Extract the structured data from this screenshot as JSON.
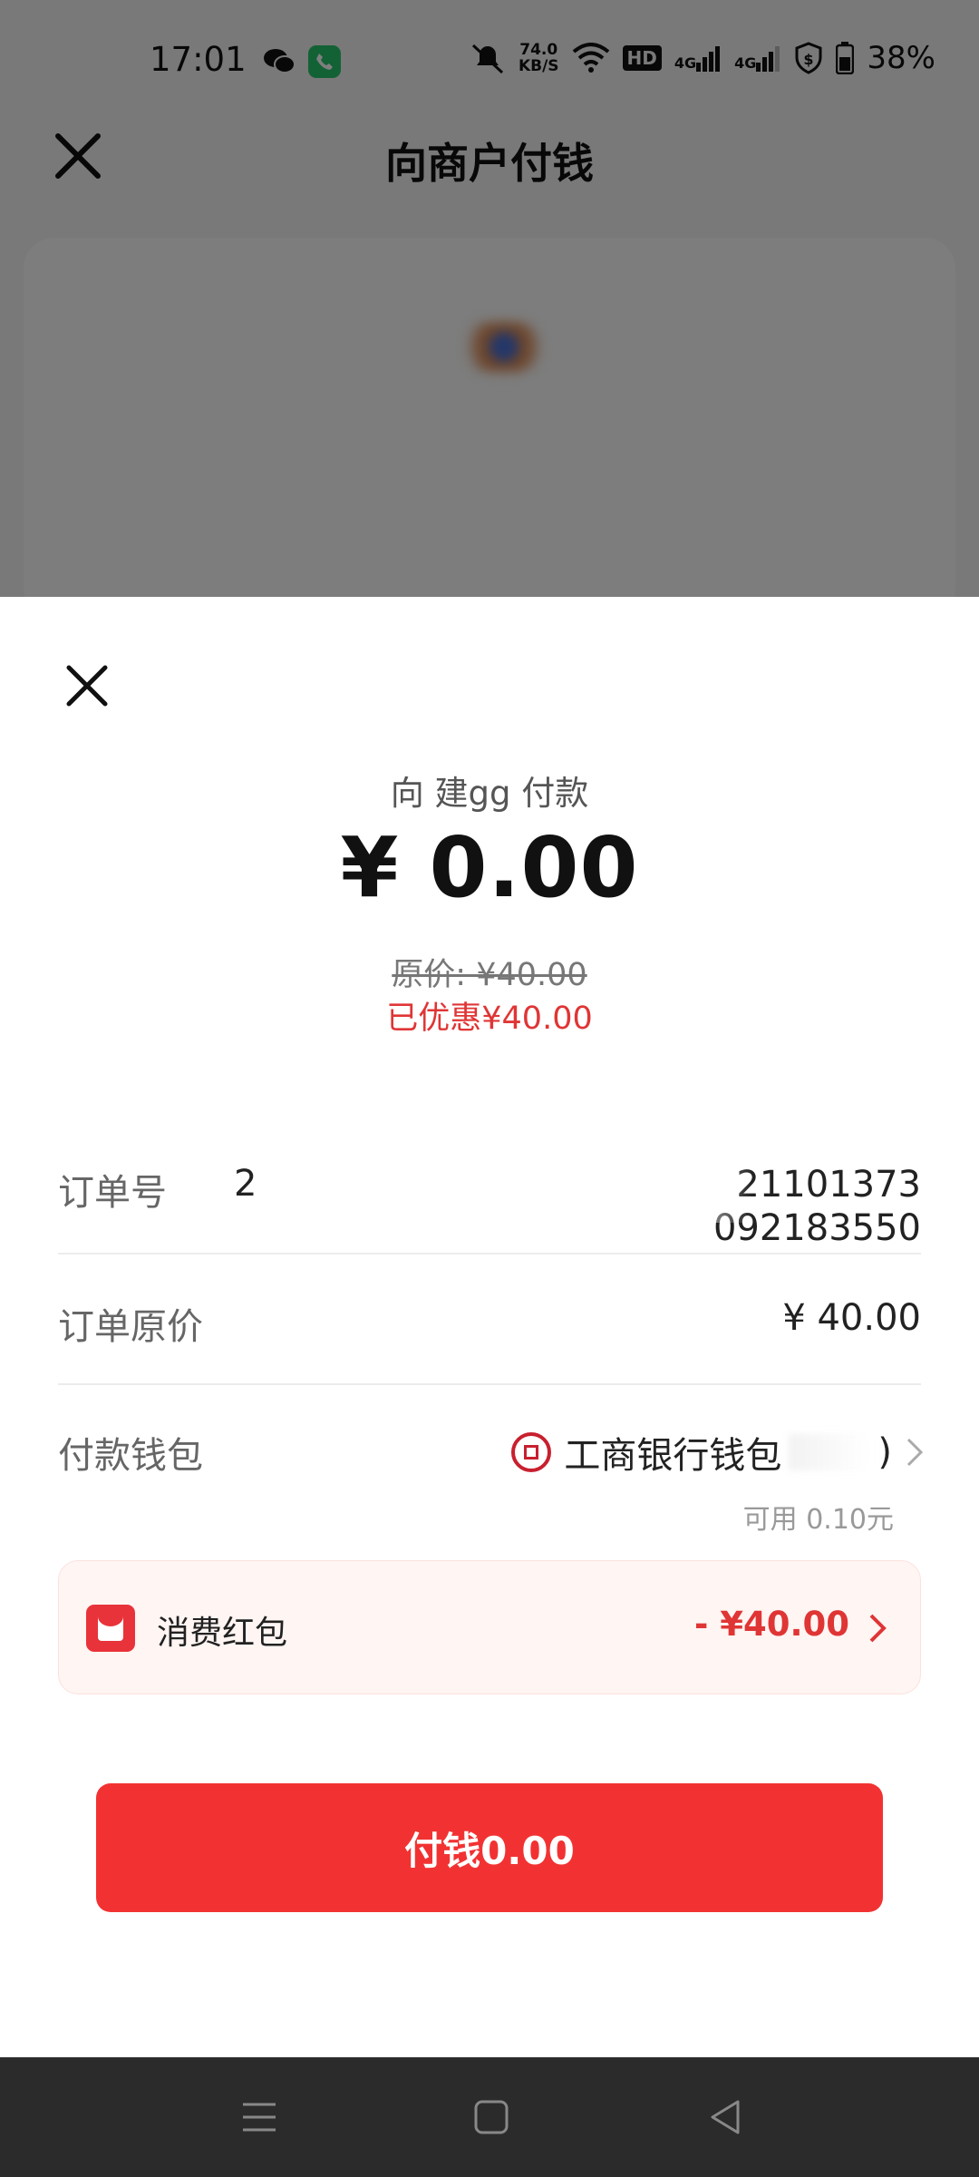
{
  "status_bar": {
    "time": "17:01",
    "net_speed_value": "74.0",
    "net_speed_unit": "KB/S",
    "hd_badge": "HD",
    "signal_1": "4G",
    "signal_2": "4G",
    "battery": "38%"
  },
  "background_app": {
    "title": "向商户付钱"
  },
  "sheet": {
    "payee": "向 建gg 付款",
    "amount": "¥ 0.00",
    "original_price": "原价: ¥40.00",
    "discount": "已优惠¥40.00",
    "order": {
      "label": "订单号",
      "prefix": "2",
      "number_line1": "21101373",
      "number_line2": "092183550"
    },
    "order_price": {
      "label": "订单原价",
      "value": "¥ 40.00"
    },
    "wallet": {
      "label": "付款钱包",
      "name": "工商银行钱包",
      "paren": ")",
      "available": "可用 0.10元"
    },
    "coupon": {
      "label": "消费红包",
      "value": "- ¥40.00"
    },
    "pay_button": "付钱0.00"
  },
  "colors": {
    "accent_red": "#f23232",
    "discount_red": "#e03535",
    "coupon_bg": "#fff5f3"
  }
}
